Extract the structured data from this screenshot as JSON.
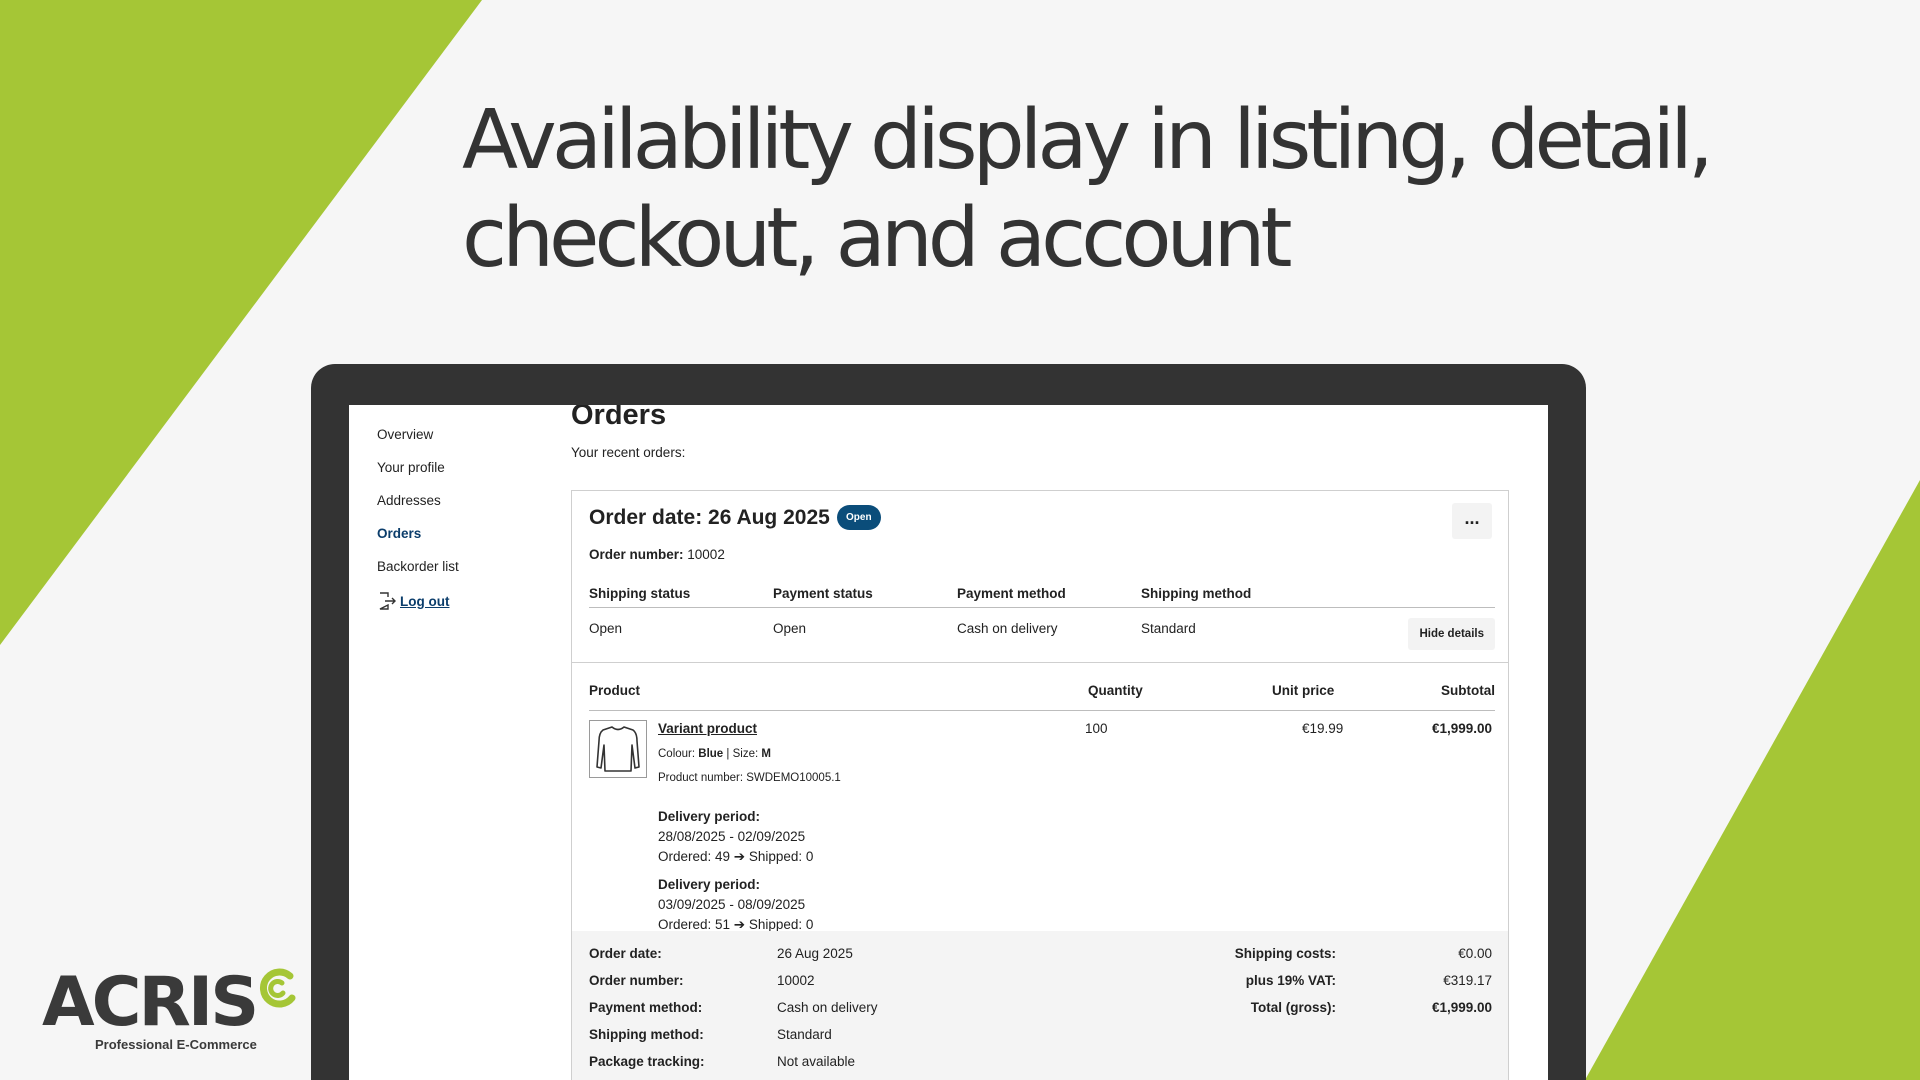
{
  "headline": {
    "line1": "Availability display in listing, detail,",
    "line2": "checkout, and account"
  },
  "colors": {
    "accent_green": "#a5c636",
    "dark": "#333333",
    "badge_blue": "#0b4d7a",
    "link_blue": "#0b3d6b"
  },
  "sidebar": {
    "items": [
      {
        "label": "Overview",
        "active": false
      },
      {
        "label": "Your profile",
        "active": false
      },
      {
        "label": "Addresses",
        "active": false
      },
      {
        "label": "Orders",
        "active": true
      },
      {
        "label": "Backorder list",
        "active": false
      }
    ],
    "logout_label": "Log out",
    "logout_icon": "logout-icon"
  },
  "main": {
    "title": "Orders",
    "subtitle": "Your recent orders:"
  },
  "order": {
    "title": "Order date: 26 Aug 2025",
    "badge": "Open",
    "more_label": "...",
    "number_label": "Order number:",
    "number_value": "10002",
    "status_headers": [
      "Shipping status",
      "Payment status",
      "Payment method",
      "Shipping method"
    ],
    "status_values": [
      "Open",
      "Open",
      "Cash on delivery",
      "Standard"
    ],
    "hide_details_label": "Hide details"
  },
  "items": {
    "headers": {
      "product": "Product",
      "quantity": "Quantity",
      "unit_price": "Unit price",
      "subtotal": "Subtotal"
    },
    "rows": [
      {
        "name": "Variant product",
        "colour_label": "Colour:",
        "colour_value": "Blue",
        "separator": "|",
        "size_label": "Size:",
        "size_value": "M",
        "product_number": "Product number: SWDEMO10005.1",
        "quantity": "100",
        "unit_price": "€19.99",
        "subtotal": "€1,999.00",
        "icon": "sweater-icon",
        "delivery": [
          {
            "label": "Delivery period:",
            "dates": "28/08/2025 - 02/09/2025",
            "progress": "Ordered: 49 ➔ Shipped: 0"
          },
          {
            "label": "Delivery period:",
            "dates": "03/09/2025 - 08/09/2025",
            "progress": "Ordered: 51 ➔ Shipped: 0"
          }
        ]
      }
    ]
  },
  "summary": {
    "left": [
      {
        "label": "Order date:",
        "value": "26 Aug 2025"
      },
      {
        "label": "Order number:",
        "value": "10002"
      },
      {
        "label": "Payment method:",
        "value": "Cash on delivery"
      },
      {
        "label": "Shipping method:",
        "value": "Standard"
      },
      {
        "label": "Package tracking:",
        "value": "Not available"
      }
    ],
    "right": [
      {
        "label": "Shipping costs:",
        "value": "€0.00",
        "bold": false
      },
      {
        "label": "plus 19% VAT:",
        "value": "€319.17",
        "bold": false
      },
      {
        "label": "Total (gross):",
        "value": "€1,999.00",
        "bold": true
      }
    ]
  },
  "logo": {
    "text": "ACRIS",
    "tagline": "Professional E-Commerce"
  }
}
